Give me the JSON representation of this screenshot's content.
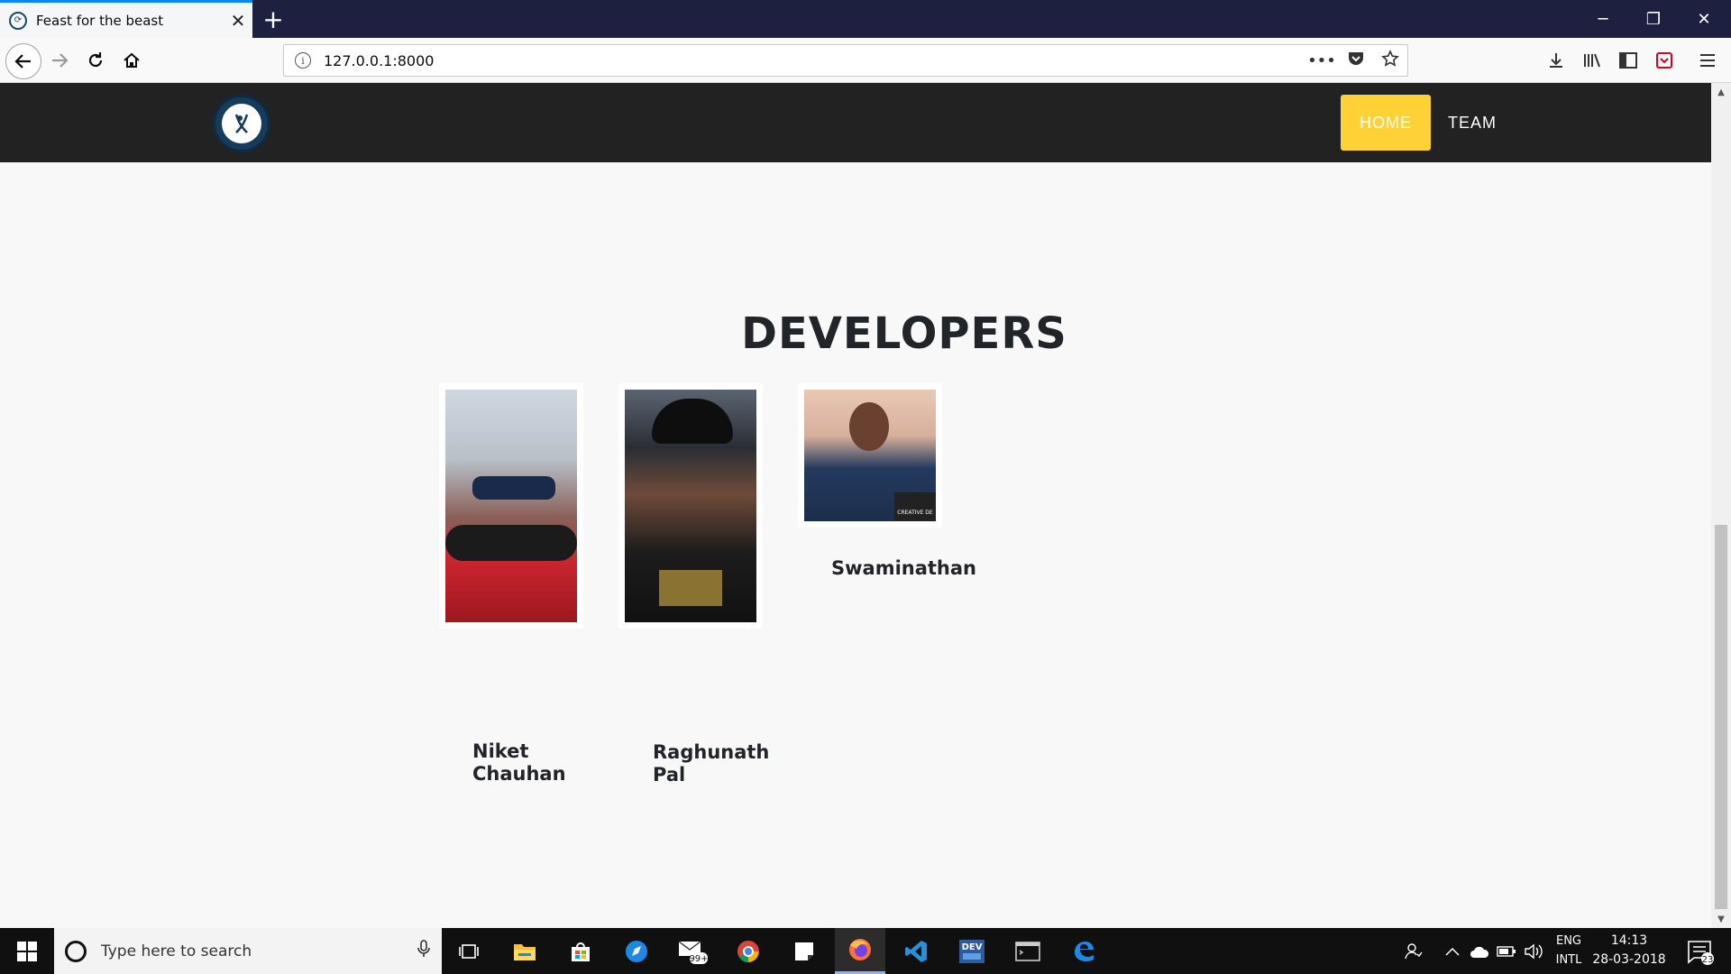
{
  "browser": {
    "tab_title": "Feast for the beast",
    "tab_close": "✕",
    "new_tab": "+",
    "window_minimize": "─",
    "window_restore": "❐",
    "window_close": "✕",
    "url": "127.0.0.1:8000",
    "url_more": "•••"
  },
  "site": {
    "menu": {
      "home": "HOME",
      "team": "TEAM"
    },
    "accent_color": "#fed136",
    "header_color": "#222222",
    "section_heading": "DEVELOPERS",
    "members": [
      {
        "name_line1": "Niket",
        "name_line2": "Chauhan"
      },
      {
        "name_line1": "Raghunath",
        "name_line2": "Pal"
      },
      {
        "name_line1": "Swaminathan",
        "name_line2": ""
      }
    ],
    "photo_watermark": "CREATIVE DE"
  },
  "taskbar": {
    "search_placeholder": "Type here to search",
    "mail_badge": "99+",
    "dev_label": "DEV",
    "lang_line1": "ENG",
    "lang_line2": "INTL",
    "time": "14:13",
    "date": "28-03-2018",
    "notifications_count": "23"
  }
}
